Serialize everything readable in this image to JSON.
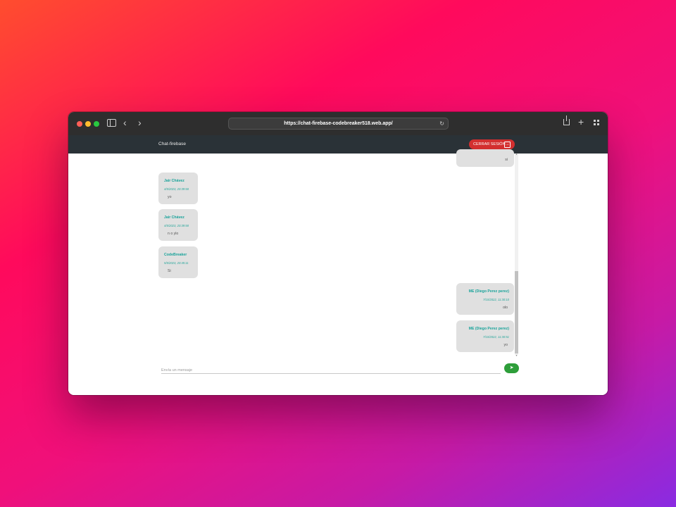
{
  "browser": {
    "url": "https://chat-firebase-codebreaker518.web.app/",
    "icons": [
      "sidebar-icon",
      "back-icon",
      "forward-icon",
      "reload-icon",
      "share-icon",
      "new-tab-icon",
      "tab-overview-icon"
    ]
  },
  "navbar": {
    "brand": "Chat-firebase",
    "logout_label": "CERRAR SESIÓN"
  },
  "messages": [
    {
      "author": "",
      "time": "",
      "text": "si",
      "mine": true
    },
    {
      "author": "Jair Chávez",
      "time": "4/5/2023, 20:39:58",
      "text": "yo",
      "mine": false
    },
    {
      "author": "Jair Chávez",
      "time": "4/5/2023, 20:39:58",
      "text": "n o ylo",
      "mine": false
    },
    {
      "author": "CodeBreaker",
      "time": "5/5/2023, 20:45:11",
      "text": "Si",
      "mine": false
    },
    {
      "author": "ME (Diego Perez perez)",
      "time": "7/10/2022, 11:30:10",
      "text": "olo",
      "mine": true
    },
    {
      "author": "ME (Diego Perez perez)",
      "time": "7/10/2022, 11:30:51",
      "text": "yo",
      "mine": true
    }
  ],
  "composer": {
    "placeholder": "Envía un mensaje",
    "send_icon": "send-icon"
  },
  "colors": {
    "navbar": "#2a3237",
    "logout_button": "#d32f2f",
    "send_button": "#2e9e3a",
    "author_text": "#1aa39a",
    "bubble": "#e0e0e0"
  }
}
